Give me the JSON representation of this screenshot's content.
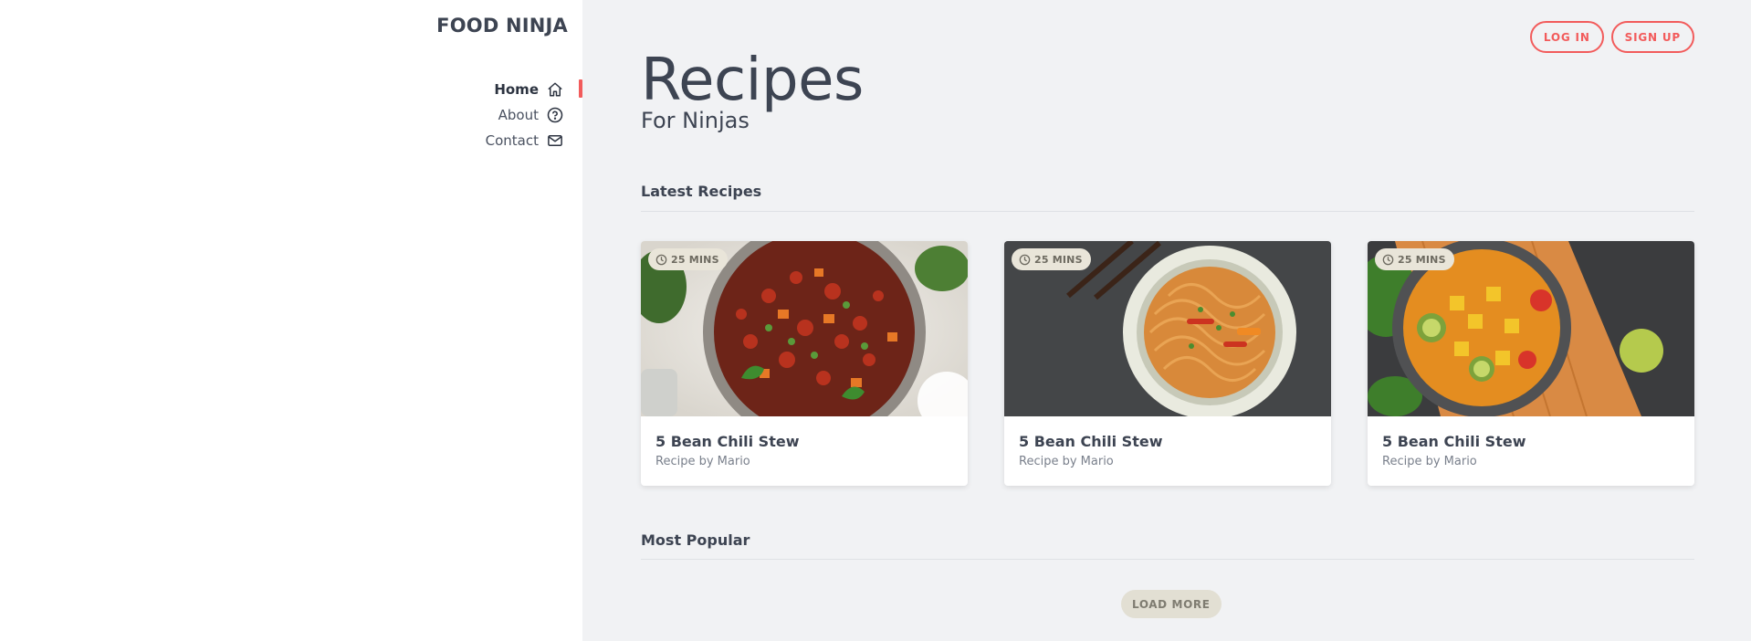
{
  "sidebar": {
    "brand": "FOOD NINJA",
    "nav": [
      {
        "label": "Home",
        "icon": "home-icon",
        "active": true
      },
      {
        "label": "About",
        "icon": "help-circle-icon",
        "active": false
      },
      {
        "label": "Contact",
        "icon": "mail-icon",
        "active": false
      }
    ]
  },
  "header": {
    "login_label": "LOG IN",
    "signup_label": "SIGN UP"
  },
  "hero": {
    "title": "Recipes",
    "subtitle": "For Ninjas"
  },
  "sections": {
    "latest": "Latest Recipes",
    "popular": "Most Popular"
  },
  "recipes": [
    {
      "title": "5 Bean Chili Stew",
      "author": "Recipe by Mario",
      "time": "25 MINS"
    },
    {
      "title": "5 Bean Chili Stew",
      "author": "Recipe by Mario",
      "time": "25 MINS"
    },
    {
      "title": "5 Bean Chili Stew",
      "author": "Recipe by Mario",
      "time": "25 MINS"
    }
  ],
  "load_more_label": "LOAD MORE",
  "colors": {
    "accent": "#f25b5b",
    "text": "#3d4452",
    "background": "#f1f2f4"
  }
}
